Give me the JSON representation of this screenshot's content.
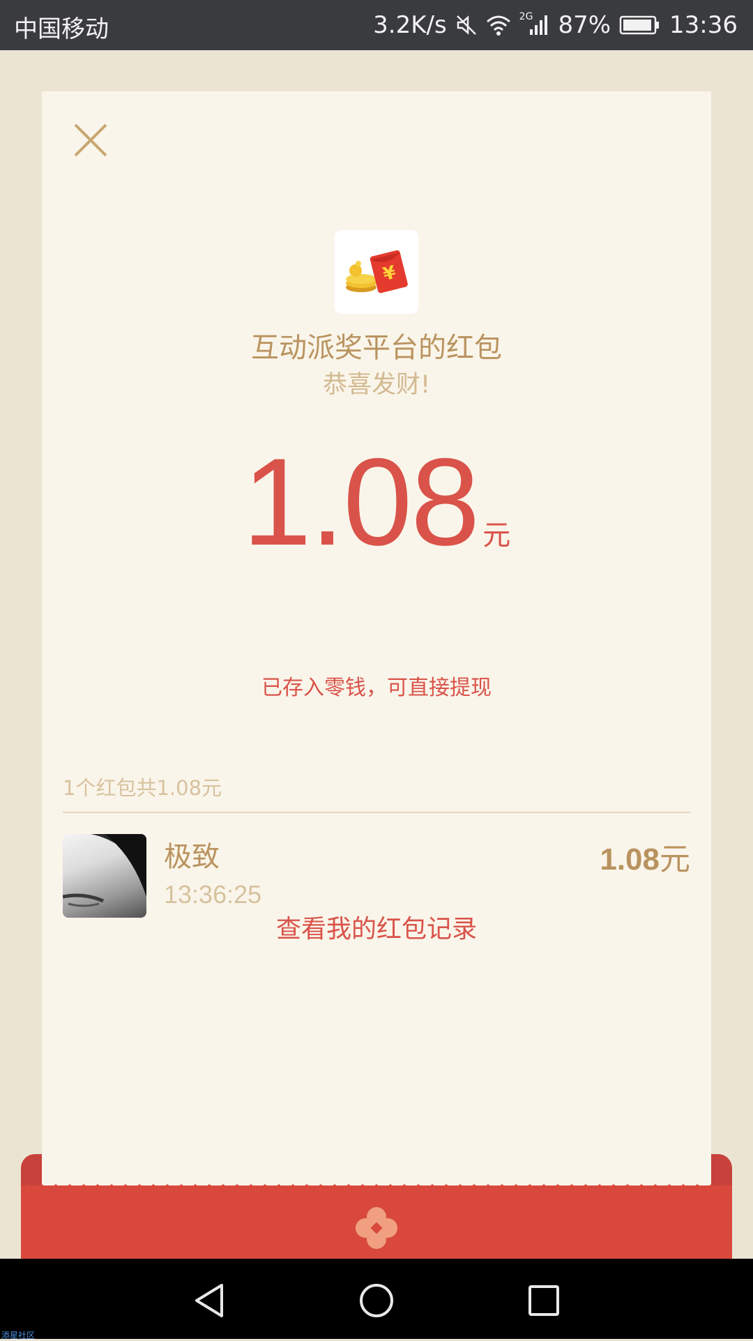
{
  "status_bar": {
    "carrier": "中国移动",
    "speed": "3.2K/s",
    "network": "2G",
    "battery": "87%",
    "time": "13:36",
    "icons": [
      "mute-icon",
      "wifi-icon",
      "signal-icon",
      "battery-icon"
    ]
  },
  "card": {
    "title": "互动派奖平台的红包",
    "subtitle": "恭喜发财!",
    "amount": "1.08",
    "amount_unit": "元",
    "note": "已存入零钱，可直接提现",
    "summary": "1个红包共1.08元",
    "records": [
      {
        "name": "极致",
        "time": "13:36:25",
        "amount": "1.08",
        "unit": "元"
      }
    ],
    "view_records": "查看我的红包记录"
  },
  "watermark": "添星社区",
  "colors": {
    "accent_red": "#d9534a",
    "gold": "#b9935f",
    "card_bg": "#faf5ea",
    "page_bg": "#ece4d3"
  }
}
